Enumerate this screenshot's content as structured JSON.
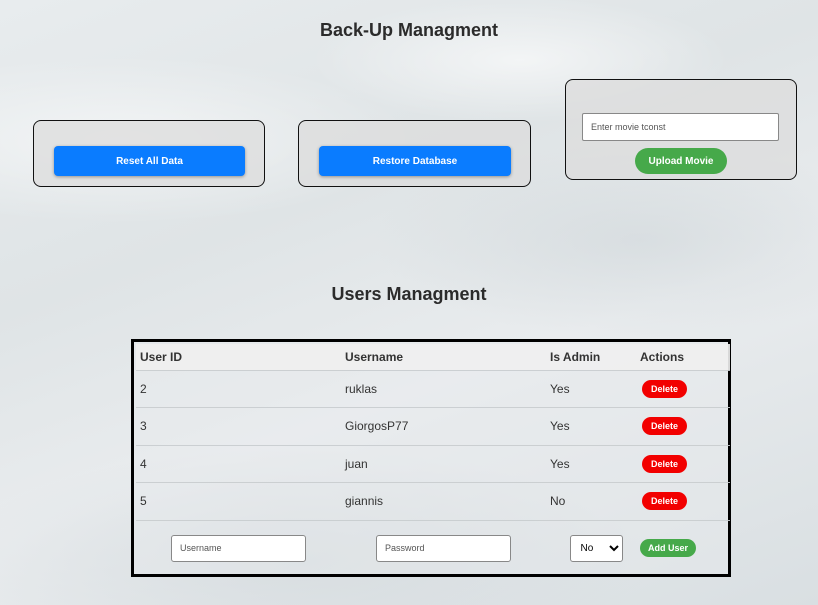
{
  "backup": {
    "title": "Back-Up Managment",
    "reset_label": "Reset All Data",
    "restore_label": "Restore Database",
    "movie_placeholder": "Enter movie tconst",
    "upload_label": "Upload Movie"
  },
  "users": {
    "title": "Users Managment",
    "columns": [
      "User ID",
      "Username",
      "Is Admin",
      "Actions"
    ],
    "rows": [
      {
        "id": "2",
        "username": "ruklas",
        "is_admin": "Yes",
        "action": "Delete"
      },
      {
        "id": "3",
        "username": "GiorgosP77",
        "is_admin": "Yes",
        "action": "Delete"
      },
      {
        "id": "4",
        "username": "juan",
        "is_admin": "Yes",
        "action": "Delete"
      },
      {
        "id": "5",
        "username": "giannis",
        "is_admin": "No",
        "action": "Delete"
      }
    ],
    "add_form": {
      "username_placeholder": "Username",
      "password_placeholder": "Password",
      "admin_selected": "No",
      "add_label": "Add User"
    }
  },
  "colors": {
    "primary_button": "#0a7cff",
    "success_button": "#46a94a",
    "danger_button": "#f20000"
  }
}
